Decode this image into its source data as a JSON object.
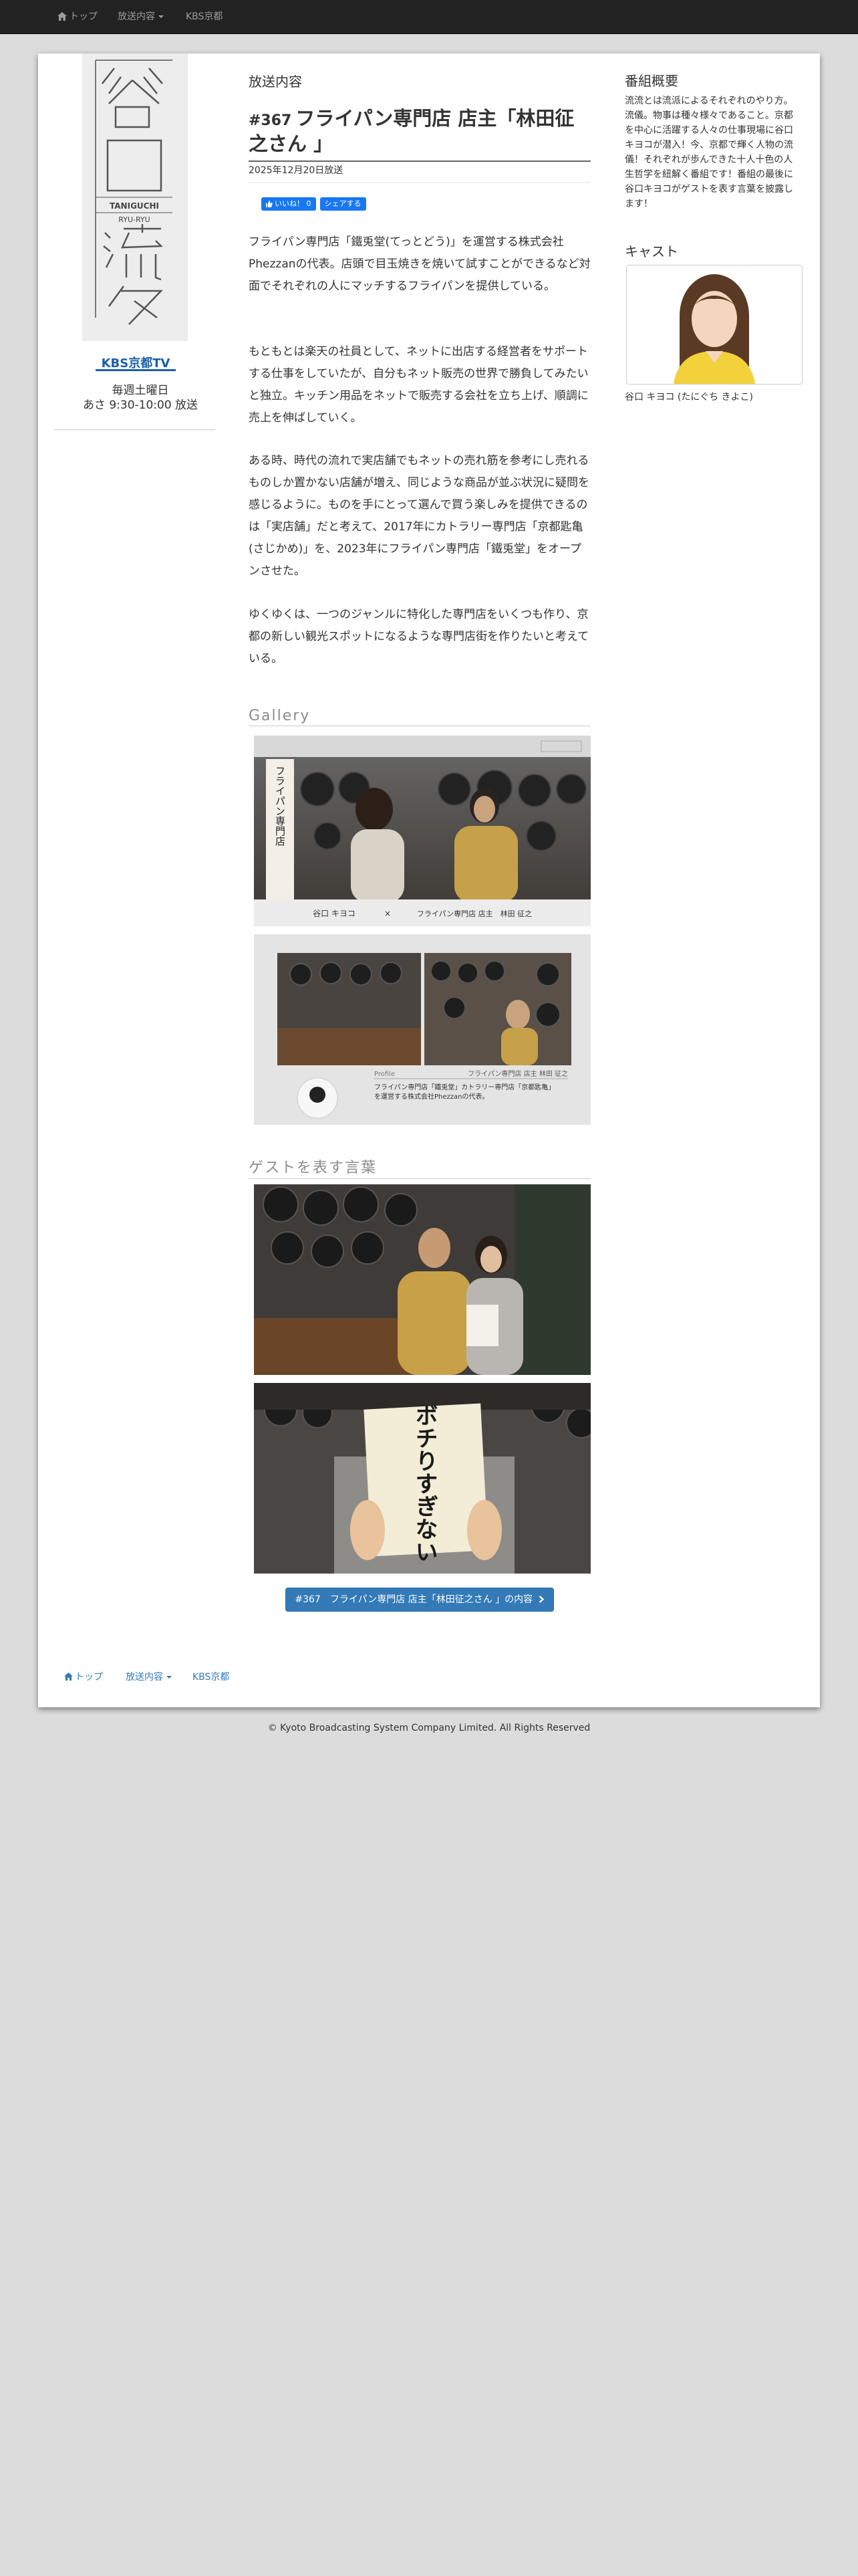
{
  "nav": {
    "home": "トップ",
    "broadcast": "放送内容",
    "kbs": "KBS京都"
  },
  "left": {
    "logo_kanji": [
      "谷",
      "口",
      "流",
      "々"
    ],
    "logo_romaji_1": "TANIGUCHI",
    "logo_romaji_2": "RYU-RYU",
    "station_logo": "KBS京都TV",
    "schedule_line1": "毎週土曜日",
    "schedule_line2": "あさ 9:30-10:00 放送"
  },
  "main": {
    "section_label": "放送内容",
    "episode_number": "#367",
    "episode_title": "フライパン専門店 店主「林田征之さん 」",
    "air_date": "2025年12月20日放送",
    "fb_like": "いいね！ 0",
    "fb_share": "シェアする",
    "paragraphs": [
      "フライパン専門店「鐵兎堂(てっとどう)」を運営する株式会社Phezzanの代表。店頭で目玉焼きを焼いて試すことができるなど対面でそれぞれの人にマッチするフライパンを提供している。",
      "もともとは楽天の社員として、ネットに出店する経営者をサポートする仕事をしていたが、自分もネット販売の世界で勝負してみたいと独立。キッチン用品をネットで販売する会社を立ち上げ、順調に売上を伸ばしていく。",
      "ある時、時代の流れで実店舗でもネットの売れ筋を参考にし売れるものしか置かない店舗が増え、同じような商品が並ぶ状況に疑問を感じるように。ものを手にとって選んで買う楽しみを提供できるのは「実店舗」だと考えて、2017年にカトラリー専門店「京都匙亀(さじかめ)」を、2023年にフライパン専門店「鐵兎堂」をオープンさせた。",
      "ゆくゆくは、一つのジャンルに特化した専門店をいくつも作り、京都の新しい観光スポットになるような専門店街を作りたいと考えている。"
    ],
    "gallery_heading": "Gallery",
    "gallery_caption_sign": "フライパン専門店",
    "gallery_caption_left": "谷口 キヨコ",
    "gallery_caption_x": "×",
    "gallery_caption_right": "フライパン専門店 店主　林田 征之",
    "gallery2_profile_label": "Profile",
    "gallery2_profile_name": "フライパン専門店 店主 林田 征之",
    "gallery2_profile_line1": "フライパン専門店「鐵兎堂」カトラリー専門店「京都匙亀」",
    "gallery2_profile_line2": "を運営する株式会社Phezzanの代表。",
    "words_heading": "ゲストを表す言葉",
    "board_text": "ボチりすぎない",
    "cta_label": "#367　フライパン専門店 店主「林田征之さん 」の内容"
  },
  "side": {
    "overview_heading": "番組概要",
    "overview_text": "流流とは流派によるそれぞれのやり方。流儀。物事は種々様々であること。京都を中心に活躍する人々の仕事現場に谷口キヨコが潜入！今、京都で輝く人物の流儀！それぞれが歩んできた十人十色の人生哲学を紐解く番組です！番組の最後に谷口キヨコがゲストを表す言葉を披露します！",
    "cast_heading": "キャスト",
    "cast_name": "谷口 キヨコ (たにぐち きよこ)"
  },
  "footer": {
    "home": "トップ",
    "broadcast": "放送内容",
    "kbs": "KBS京都",
    "copyright": "© Kyoto Broadcasting System Company Limited. All Rights Reserved"
  },
  "colors": {
    "navbar": "#222222",
    "link": "#337ab7",
    "facebook": "#1877f2",
    "background": "#dcdcdc"
  },
  "icons": [
    "home-icon",
    "thumbs-up-icon",
    "chevron-right-icon",
    "caret-down-icon"
  ]
}
